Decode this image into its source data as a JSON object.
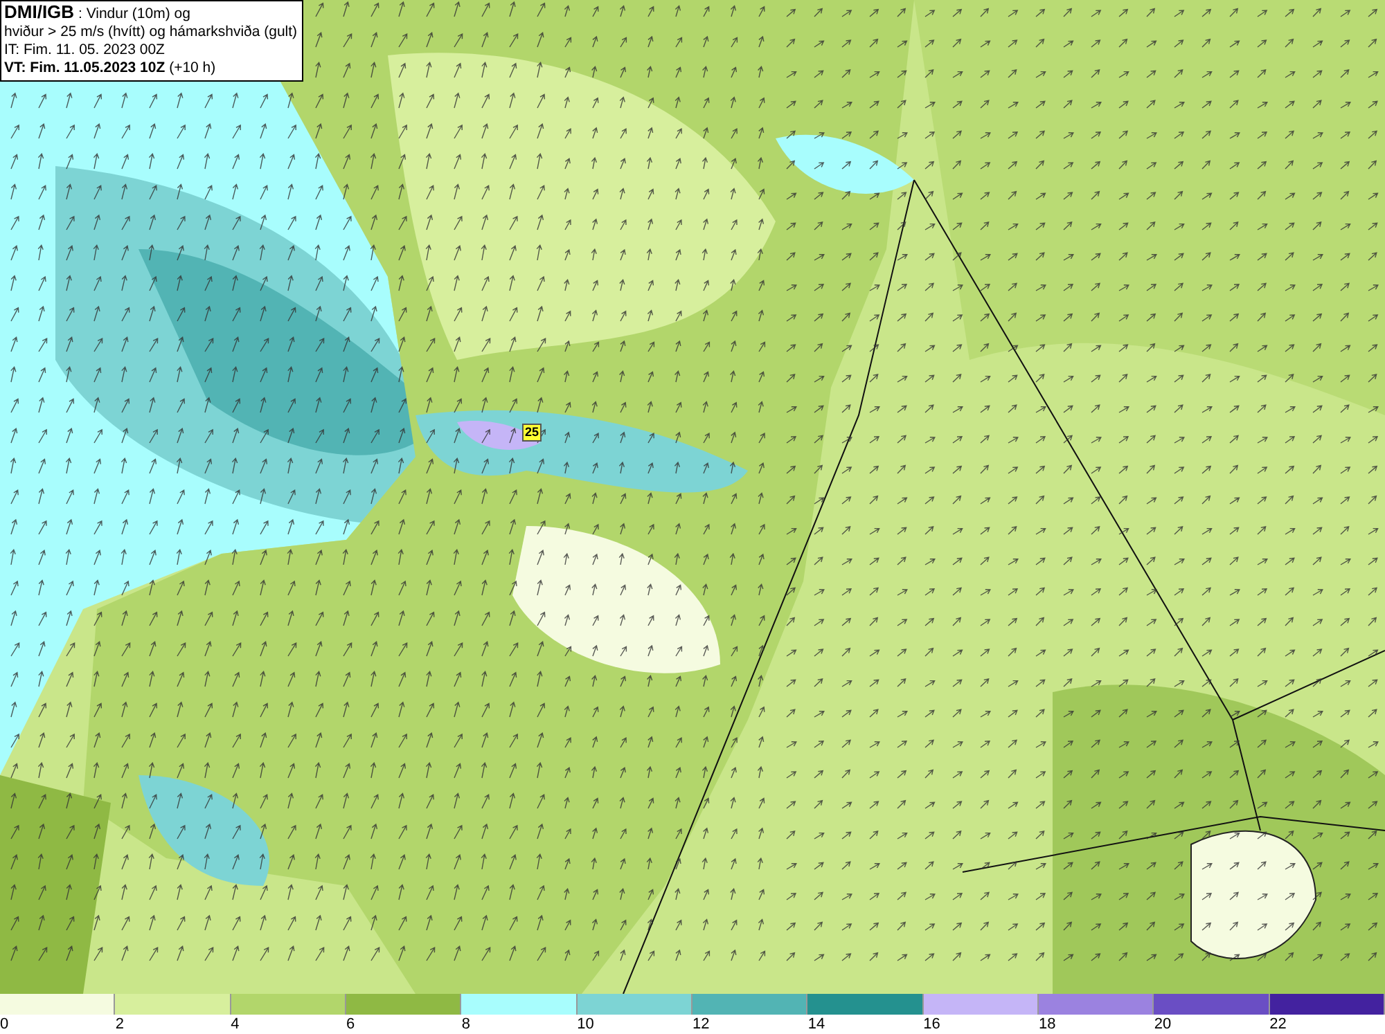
{
  "title_box": {
    "lines": [
      "**DMI/IGB** : Vindur (10m) og",
      "hviður > 25 m/s (hvítt) og hámarkshviða (gult)",
      "IT: Fim. 11. 05. 2023 00Z",
      "**VT: Fim. 11.05.2023 10Z** (+10 h)"
    ]
  },
  "map": {
    "gust_marker": {
      "label": "25"
    }
  },
  "legend": {
    "items": [
      {
        "label": "0",
        "color": "#f5fbe0"
      },
      {
        "label": "2",
        "color": "#d7ef9d"
      },
      {
        "label": "4",
        "color": "#b2d66b"
      },
      {
        "label": "6",
        "color": "#8fb944"
      },
      {
        "label": "8",
        "color": "#a8fdfd"
      },
      {
        "label": "10",
        "color": "#7dd4d4"
      },
      {
        "label": "12",
        "color": "#52b4b4"
      },
      {
        "label": "14",
        "color": "#24918f"
      },
      {
        "label": "16",
        "color": "#c5b5f7"
      },
      {
        "label": "18",
        "color": "#9b82e0"
      },
      {
        "label": "20",
        "color": "#6a4ec4"
      },
      {
        "label": "22",
        "color": "#43229f"
      }
    ]
  }
}
